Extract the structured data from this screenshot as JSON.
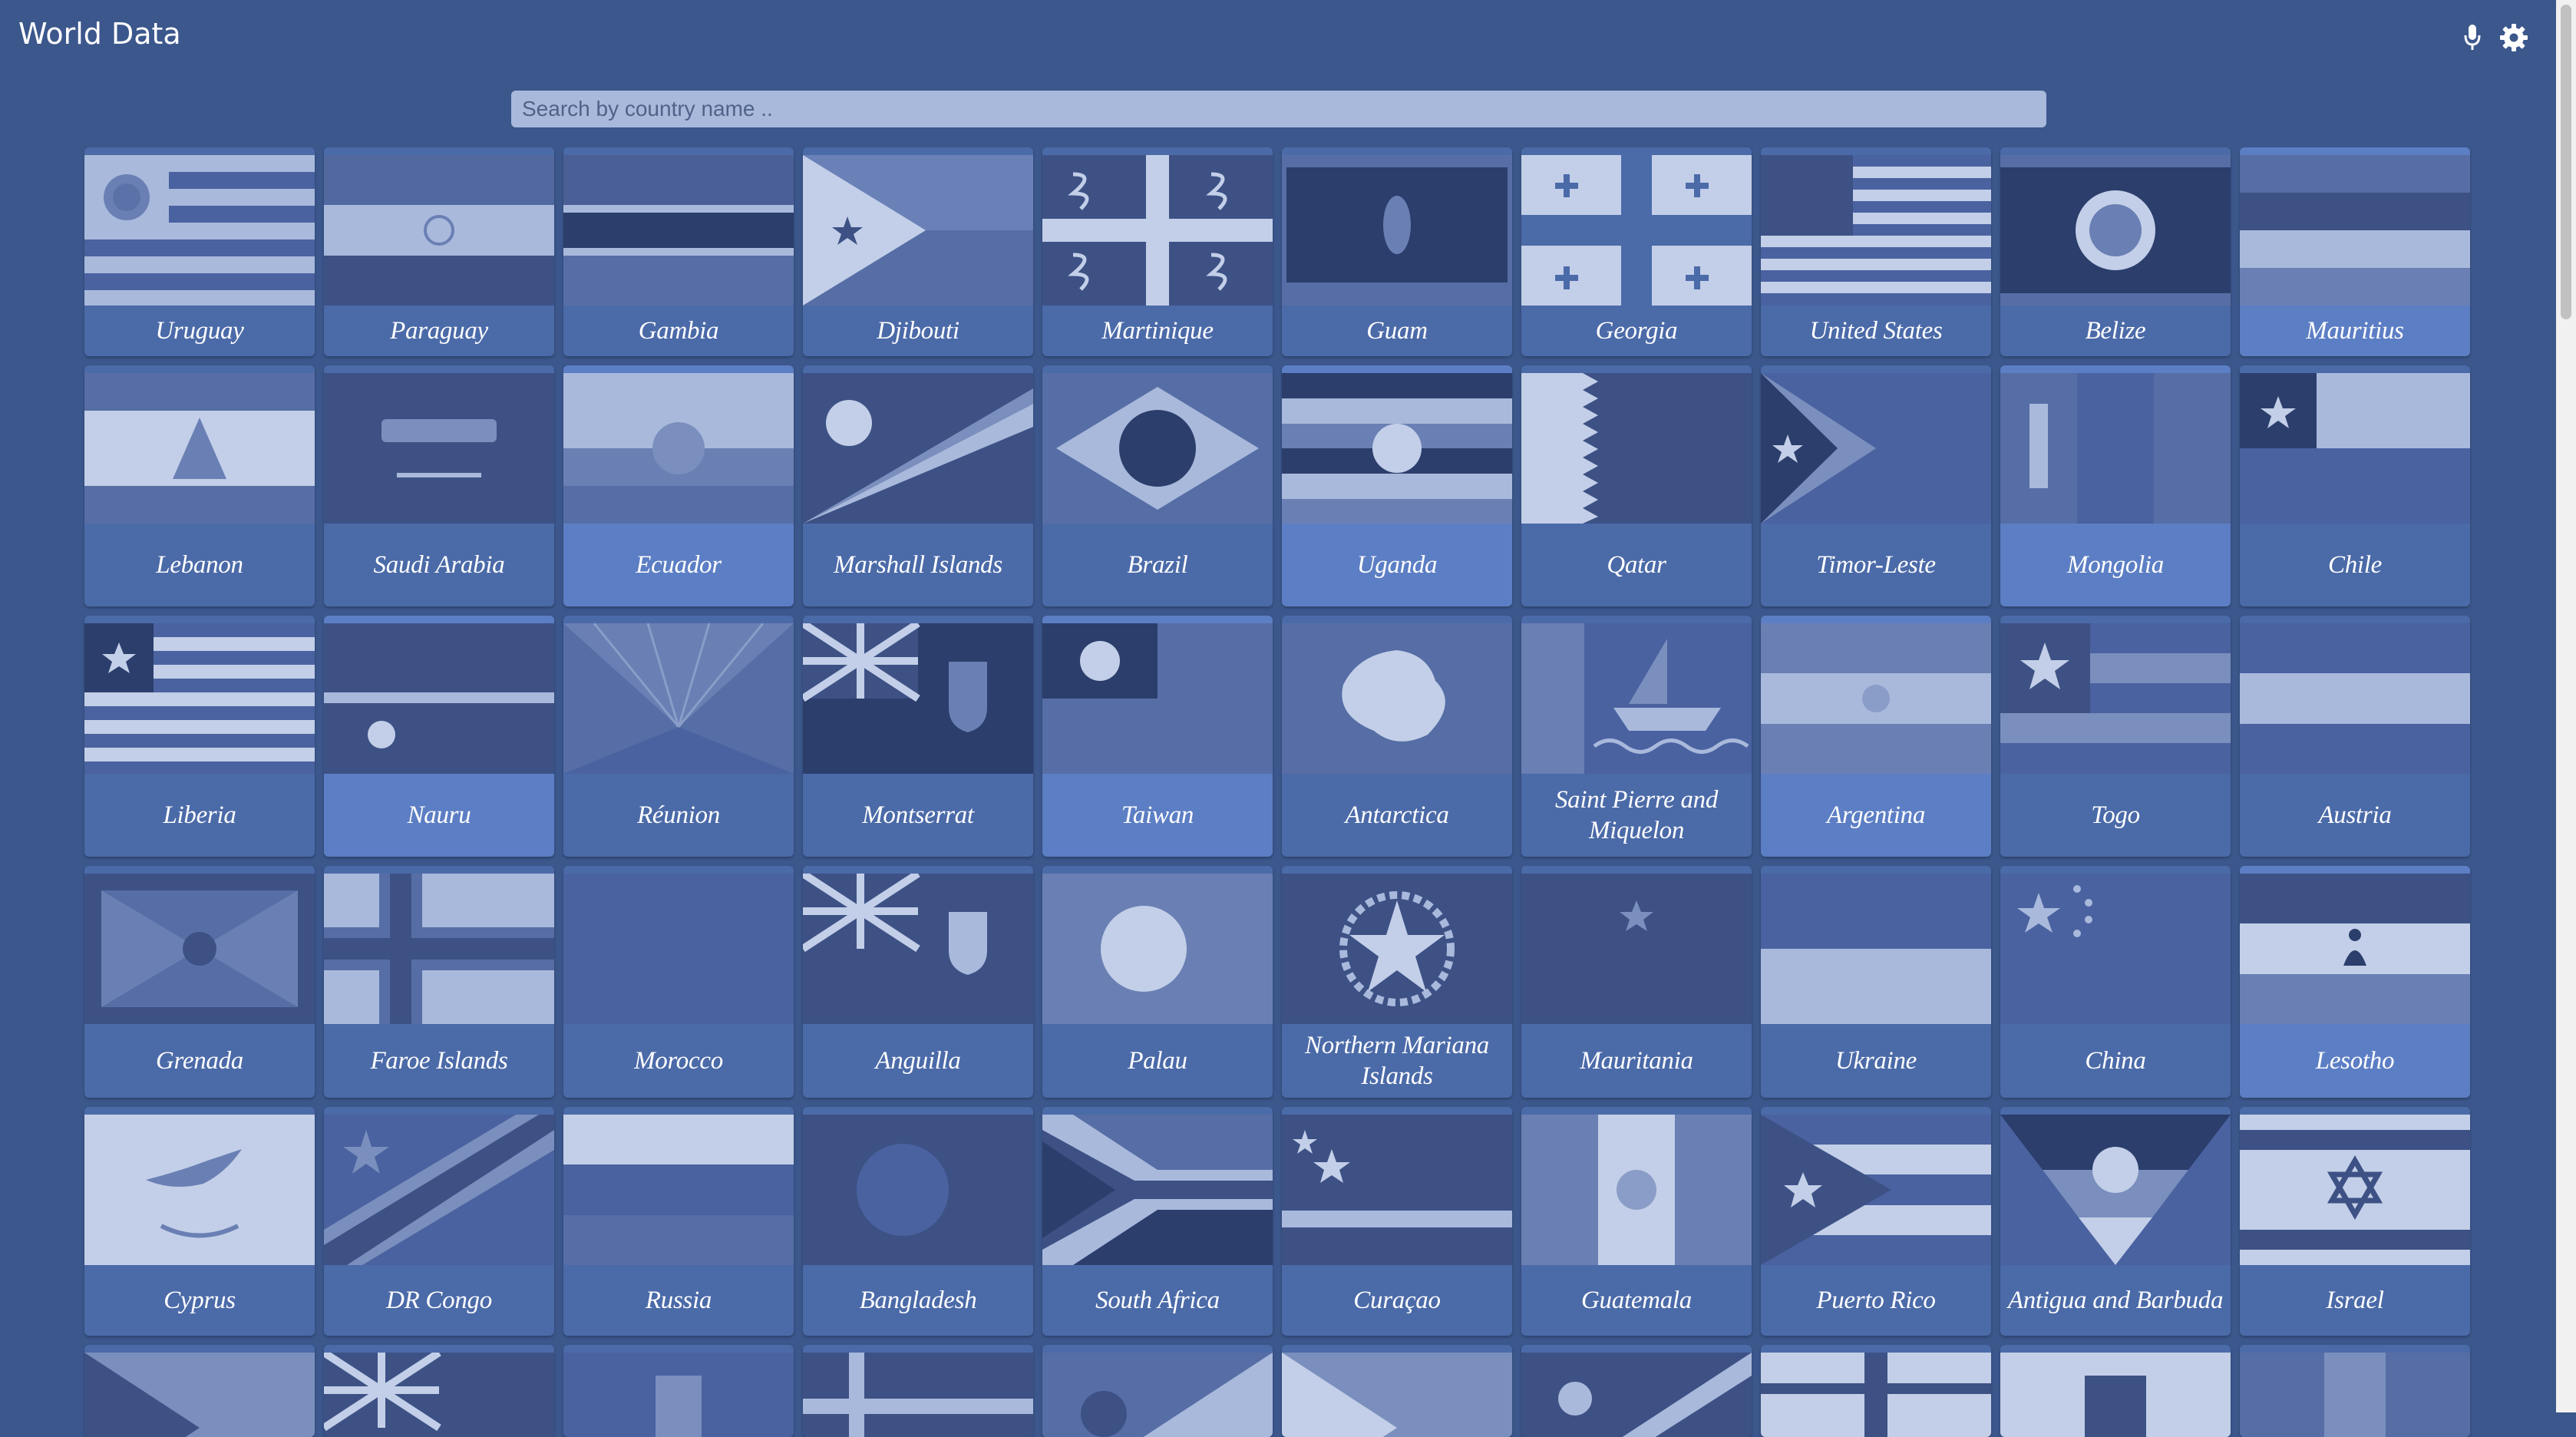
{
  "app": {
    "title": "World Data"
  },
  "toolbar": {
    "mic_icon": "microphone-icon",
    "settings_icon": "gear-icon"
  },
  "search": {
    "placeholder": "Search by country name ..",
    "value": ""
  },
  "countries": [
    "Uruguay",
    "Paraguay",
    "Gambia",
    "Djibouti",
    "Martinique",
    "Guam",
    "Georgia",
    "United States",
    "Belize",
    "Mauritius",
    "Lebanon",
    "Saudi Arabia",
    "Ecuador",
    "Marshall Islands",
    "Brazil",
    "Uganda",
    "Qatar",
    "Timor-Leste",
    "Mongolia",
    "Chile",
    "Liberia",
    "Nauru",
    "Réunion",
    "Montserrat",
    "Taiwan",
    "Antarctica",
    "Saint Pierre and Miquelon",
    "Argentina",
    "Togo",
    "Austria",
    "Grenada",
    "Faroe Islands",
    "Morocco",
    "Anguilla",
    "Palau",
    "Northern Mariana Islands",
    "Mauritania",
    "Ukraine",
    "China",
    "Lesotho",
    "Cyprus",
    "DR Congo",
    "Russia",
    "Bangladesh",
    "South Africa",
    "Curaçao",
    "Guatemala",
    "Puerto Rico",
    "Antigua and Barbuda",
    "Israel"
  ],
  "colors": {
    "background": "#3b578c",
    "card": "#4b6aa8",
    "card_alt": "#5c7ec4",
    "search_bg": "#a9b9dc"
  }
}
